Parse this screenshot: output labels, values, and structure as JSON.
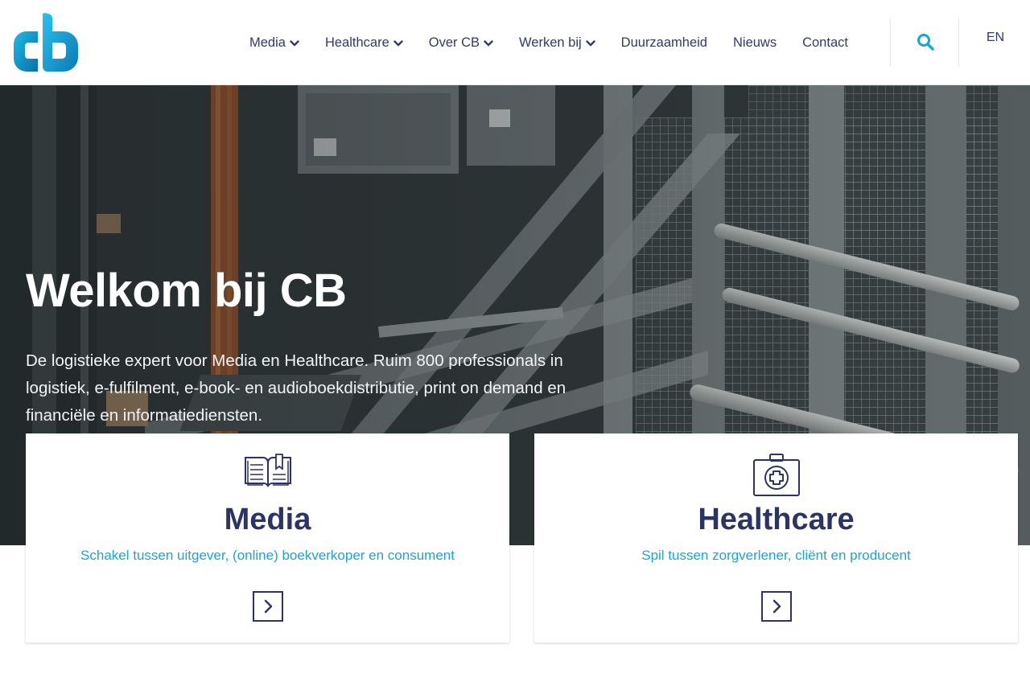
{
  "brand": {
    "logo_text": "cb",
    "colors": {
      "primary": "#2b3467",
      "accent": "#19a6d2"
    }
  },
  "nav": {
    "items": [
      {
        "label": "Media",
        "dropdown": true
      },
      {
        "label": "Healthcare",
        "dropdown": true
      },
      {
        "label": "Over CB",
        "dropdown": true
      },
      {
        "label": "Werken bij",
        "dropdown": true
      },
      {
        "label": "Duurzaamheid",
        "dropdown": false
      },
      {
        "label": "Nieuws",
        "dropdown": false
      },
      {
        "label": "Contact",
        "dropdown": false
      }
    ],
    "search_icon": "search-icon",
    "language": "EN"
  },
  "hero": {
    "title": "Welkom bij CB",
    "text": "De logistieke expert voor Media en Healthcare. Ruim 800 professionals in logistiek, e-fulfilment, e-book- en audioboekdistributie, print on demand en financiële en informatiediensten."
  },
  "cards": [
    {
      "icon": "open-book-icon",
      "title": "Media",
      "subtitle": "Schakel tussen uitgever, (online) boekverkoper en consument",
      "arrow_icon": "chevron-right-icon"
    },
    {
      "icon": "medical-kit-icon",
      "title": "Healthcare",
      "subtitle": "Spil tussen zorgverlener, cliënt en producent",
      "arrow_icon": "chevron-right-icon"
    }
  ]
}
